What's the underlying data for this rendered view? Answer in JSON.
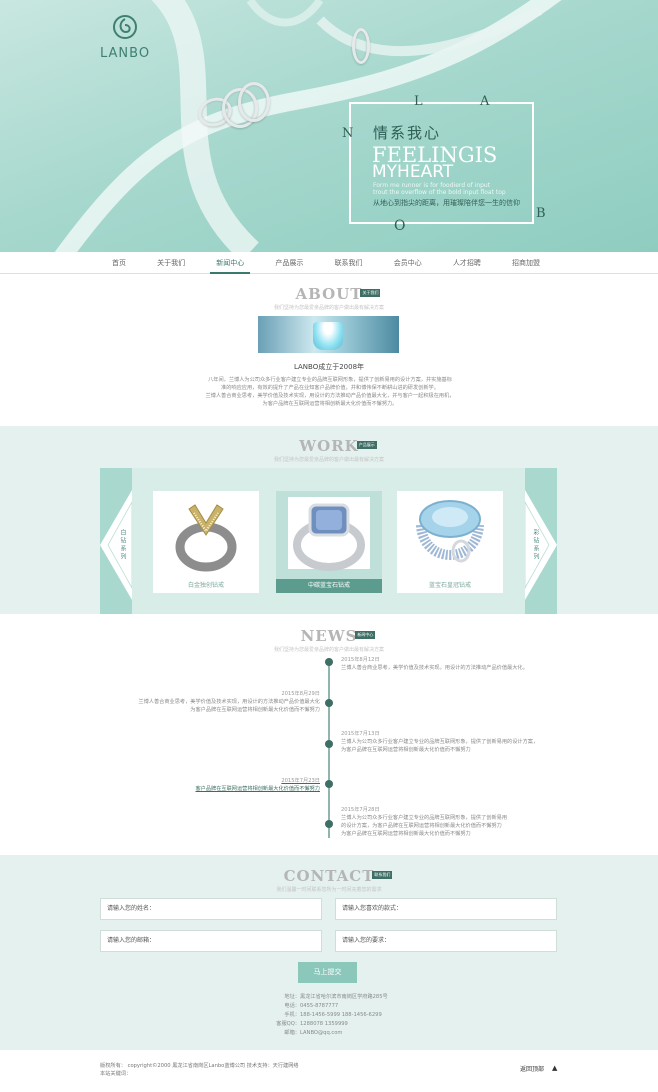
{
  "brand": {
    "name": "LANBO"
  },
  "hero": {
    "frame_letters": [
      "N",
      "L",
      "A",
      "B",
      "O"
    ],
    "title_cn": "情系我心",
    "title_en_1": "FEELINGIS",
    "title_en_2": "MYHEART",
    "small_1": "Form me runner is for foodierd of input",
    "small_2": "trout the overflow of the bold input float top",
    "tagline": "从地心到指尖的距离，用璀璨陪伴您一生的信仰"
  },
  "nav": {
    "items": [
      "首页",
      "关于我们",
      "新闻中心",
      "产品展示",
      "联系我们",
      "会员中心",
      "人才招聘",
      "招商加盟"
    ],
    "active_index": 2
  },
  "about": {
    "title": "ABOUT",
    "tag": "关于我们",
    "subtitle": "我们坚持为您最爱亲品牌的客户做出最有解决方案",
    "headline": "LANBO成立于2008年",
    "lines": [
      "八年间，兰博人为公司众多行业客户建立专业的品牌互联网形象，提供了创新易用的设计方案，并实施基标",
      "准的响应应用，有效的提升了产品在业知客户品牌价值，并和博伟保不断耕山进的研发创新学。",
      "兰博人善合商业思考，美学价值及技术实现，用设计的方法推动产品价值最大化，并与客户一起积极在用机，",
      "为客户品牌在互联网运营将相创新最大化价值而不懈努力。"
    ]
  },
  "work": {
    "title": "WORK",
    "tag": "产品展示",
    "subtitle": "我们坚持为您最爱亲品牌的客户做出最有解决方案",
    "left_label": "白钻系列",
    "right_label": "彩钻系列",
    "products": [
      {
        "name": "白金独创钻戒",
        "icon": "ring-gold-icon"
      },
      {
        "name": "中碳蓝宝石钻戒",
        "icon": "ring-sapphire-icon"
      },
      {
        "name": "蓝宝石皇冠钻戒",
        "icon": "ring-aquamarine-icon"
      }
    ]
  },
  "news": {
    "title": "NEWS",
    "tag": "新闻中心",
    "subtitle": "我们坚持为您最爱亲品牌的客户做出最有解决方案",
    "items": [
      {
        "side": "right",
        "date": "2015年8月12日",
        "text": [
          "兰博人善合商业思考，美学价值及技术实现，用设计的方法推动产品价值最大化。"
        ]
      },
      {
        "side": "left",
        "date": "2015年8月29日",
        "text": [
          "兰博人善合商业思考，美学价值及技术实现，用设计的方法推动产品价值最大化",
          "为客户品牌在互联网运营将相创新最大化价值而不懈努力"
        ]
      },
      {
        "side": "right",
        "date": "2015年7月13日",
        "text": [
          "兰博人为公司众多行业客户建立专业的品牌互联网形象，提供了创新易用的设计方案，",
          "为客户品牌在互联网运营将相创新最大化价值而不懈努力"
        ]
      },
      {
        "side": "left",
        "date": "2015年7月23日",
        "text": [
          "客户品牌在互联网运营将相创新最大化价值而不懈努力"
        ],
        "highlight": true
      },
      {
        "side": "right",
        "date": "2015年7月28日",
        "text": [
          "兰博人为公司众多行业客户建立专业的品牌互联网形象，提供了创新易用",
          "的设计方案，为客户品牌在互联网运营将相创新最大化价值而不懈努力",
          "为客户品牌在互联网运营将相创新最大化价值而不懈努力"
        ]
      }
    ]
  },
  "contact": {
    "title": "CONTACT",
    "tag": "联系我们",
    "subtitle": "我们温馨一时间联系您所为一时间充着您的需求",
    "fields": {
      "name": "请输入您的姓名：",
      "style": "请输入您喜欢的款式：",
      "email": "请输入您的邮箱：",
      "message": "请输入您的要求："
    },
    "submit": "马上提交",
    "address": [
      {
        "k": "地址：",
        "v": "黑龙江省哈尔滨市南岗区学府路285号"
      },
      {
        "k": "电话：",
        "v": "0455-8787777"
      },
      {
        "k": "手机：",
        "v": "188-1456-5999  188-1456-6299"
      },
      {
        "k": "客服QQ：",
        "v": "1288078  1359999"
      },
      {
        "k": "邮箱：",
        "v": "LANBO@qq.com"
      }
    ]
  },
  "footer": {
    "line1": "版权所有： copyright©2000 黑龙江省南岗区Lanbo蓝博公司  技术支持：天行建网络",
    "line2": "本站关键词：",
    "back_top": "返回顶部"
  },
  "colors": {
    "accent": "#3e6e66",
    "mint": "#a8d8ce",
    "light": "#e4f1ee"
  }
}
